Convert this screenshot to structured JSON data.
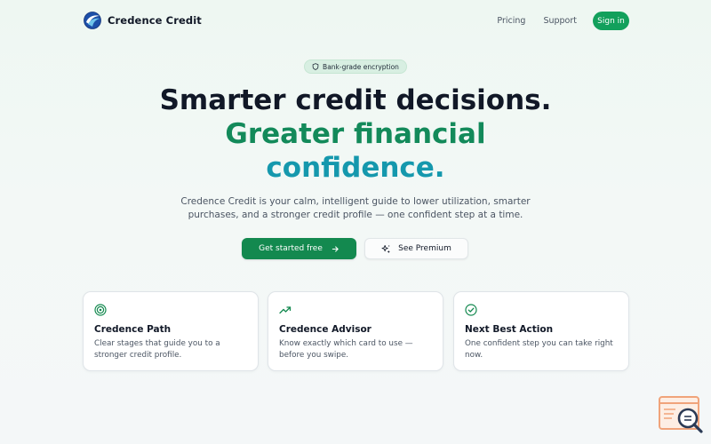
{
  "brand": {
    "name": "Credence Credit",
    "logo": "credence-swirl-logo"
  },
  "nav": {
    "pricing": "Pricing",
    "support": "Support",
    "signin": "Sign in"
  },
  "hero": {
    "badge": "Bank-grade encryption",
    "badge_icon": "shield-icon",
    "title_line1": "Smarter credit decisions.",
    "title_line2": "Greater financial",
    "title_line3": "confidence.",
    "subtitle_line1": "Credence Credit is your calm, intelligent guide to lower utilization, smarter",
    "subtitle_line2": "purchases, and a stronger credit profile — one confident step at a time.",
    "primary_cta": "Get started free",
    "secondary_cta": "See Premium"
  },
  "features": [
    {
      "icon": "target-icon",
      "title": "Credence Path",
      "desc": "Clear stages that guide you to a stronger credit profile."
    },
    {
      "icon": "trending-up-icon",
      "title": "Credence Advisor",
      "desc": "Know exactly which card to use — before you swipe."
    },
    {
      "icon": "check-circle-icon",
      "title": "Next Best Action",
      "desc": "One confident step you can take right now."
    }
  ],
  "colors": {
    "accent_green": "#13894f",
    "title_green": "#138a5a",
    "title_teal": "#1598ad",
    "widget_orange": "#f0a37a"
  }
}
